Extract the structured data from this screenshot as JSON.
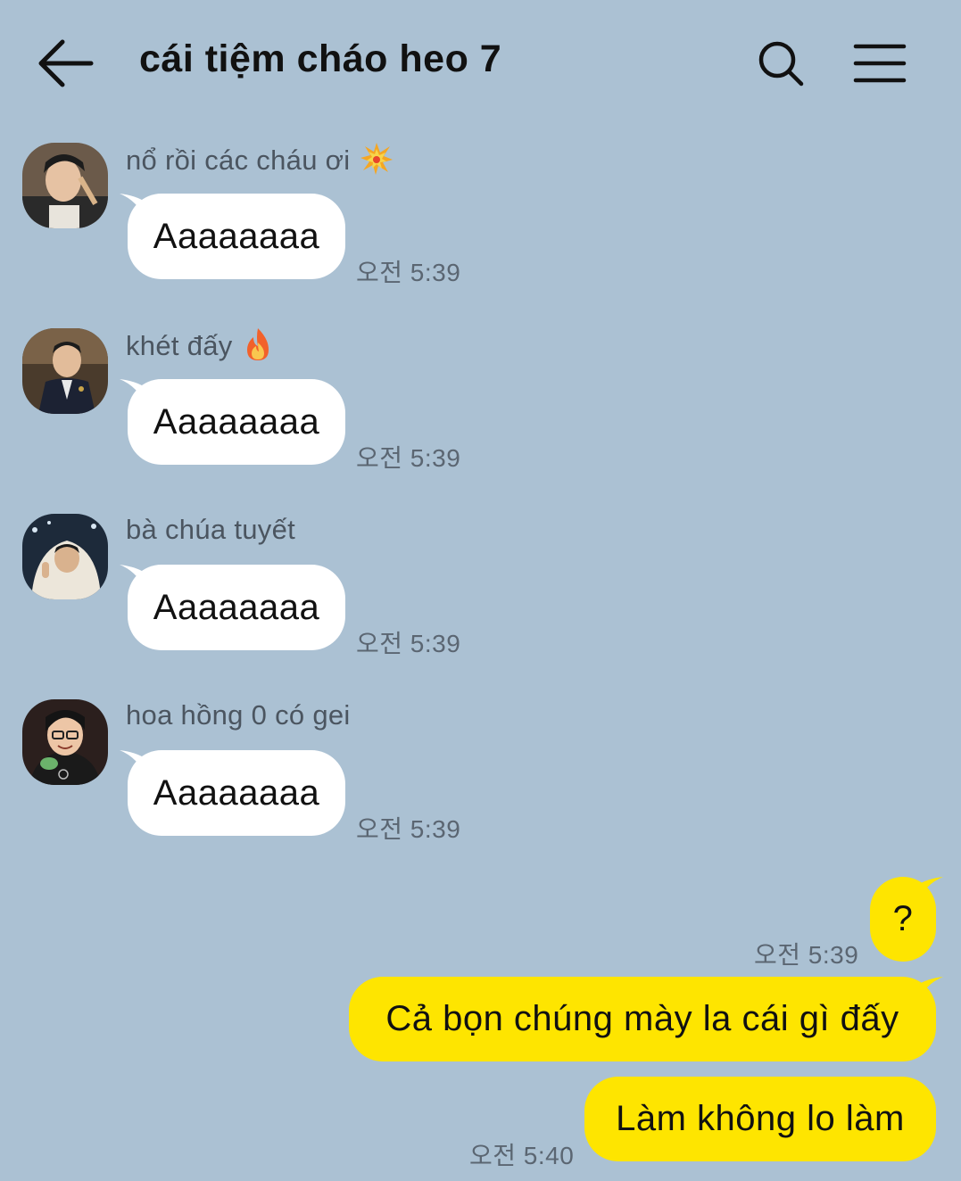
{
  "header": {
    "title": "cái tiệm cháo heo 7",
    "back_icon": "arrow-left-icon",
    "search_icon": "search-icon",
    "menu_icon": "hamburger-menu-icon"
  },
  "messages_in": [
    {
      "sender": "nổ rồi các cháu ơi",
      "emoji": "collision-emoji",
      "text": "Aaaaaaaa",
      "time": "오전 5:39"
    },
    {
      "sender": "khét đấy",
      "emoji": "fire-emoji",
      "text": "Aaaaaaaa",
      "time": "오전 5:39"
    },
    {
      "sender": "bà chúa tuyết",
      "emoji": "",
      "text": "Aaaaaaaa",
      "time": "오전 5:39"
    },
    {
      "sender": "hoa hồng 0 có gei",
      "emoji": "",
      "text": "Aaaaaaaa",
      "time": "오전 5:39"
    }
  ],
  "messages_out": [
    {
      "text": "?",
      "time": "오전 5:39"
    },
    {
      "text": "Cả bọn chúng mày la cái gì đấy",
      "time": ""
    },
    {
      "text": "Làm không lo làm",
      "time": "오전 5:40"
    }
  ],
  "colors": {
    "background": "#abc1d3",
    "incoming_bubble": "#ffffff",
    "outgoing_bubble": "#fee500"
  }
}
